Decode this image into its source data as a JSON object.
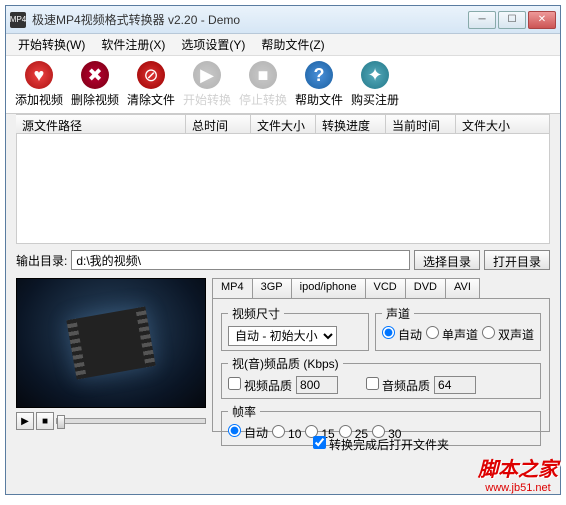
{
  "window": {
    "title": "极速MP4视频格式转换器 v2.20 - Demo",
    "icon_label": "MP4"
  },
  "menu": [
    "开始转换(W)",
    "软件注册(X)",
    "选项设置(Y)",
    "帮助文件(Z)"
  ],
  "toolbar": {
    "add": "添加视频",
    "delete": "删除视频",
    "clear": "清除文件",
    "start": "开始转换",
    "stop": "停止转换",
    "help": "帮助文件",
    "buy": "购买注册"
  },
  "table": {
    "cols": [
      "源文件路径",
      "总时间",
      "文件大小",
      "转换进度",
      "当前时间",
      "文件大小"
    ]
  },
  "output": {
    "label": "输出目录:",
    "path": "d:\\我的视频\\",
    "select_btn": "选择目录",
    "open_btn": "打开目录"
  },
  "format_tabs": [
    "MP4",
    "3GP",
    "ipod/iphone",
    "VCD",
    "DVD",
    "AVI"
  ],
  "settings": {
    "video_size": {
      "legend": "视频尺寸",
      "value": "自动 - 初始大小"
    },
    "channel": {
      "legend": "声道",
      "options": [
        "自动",
        "单声道",
        "双声道"
      ],
      "selected": "自动"
    },
    "quality": {
      "legend": "视(音)频品质 (Kbps)",
      "video_label": "视频品质",
      "video_value": "800",
      "audio_label": "音频品质",
      "audio_value": "64"
    },
    "fps": {
      "legend": "帧率",
      "options": [
        "自动",
        "10",
        "15",
        "25",
        "30"
      ],
      "selected": "自动"
    },
    "open_after": "转换完成后打开文件夹"
  },
  "watermark": {
    "main": "脚本之家",
    "sub": "www.jb51.net"
  }
}
